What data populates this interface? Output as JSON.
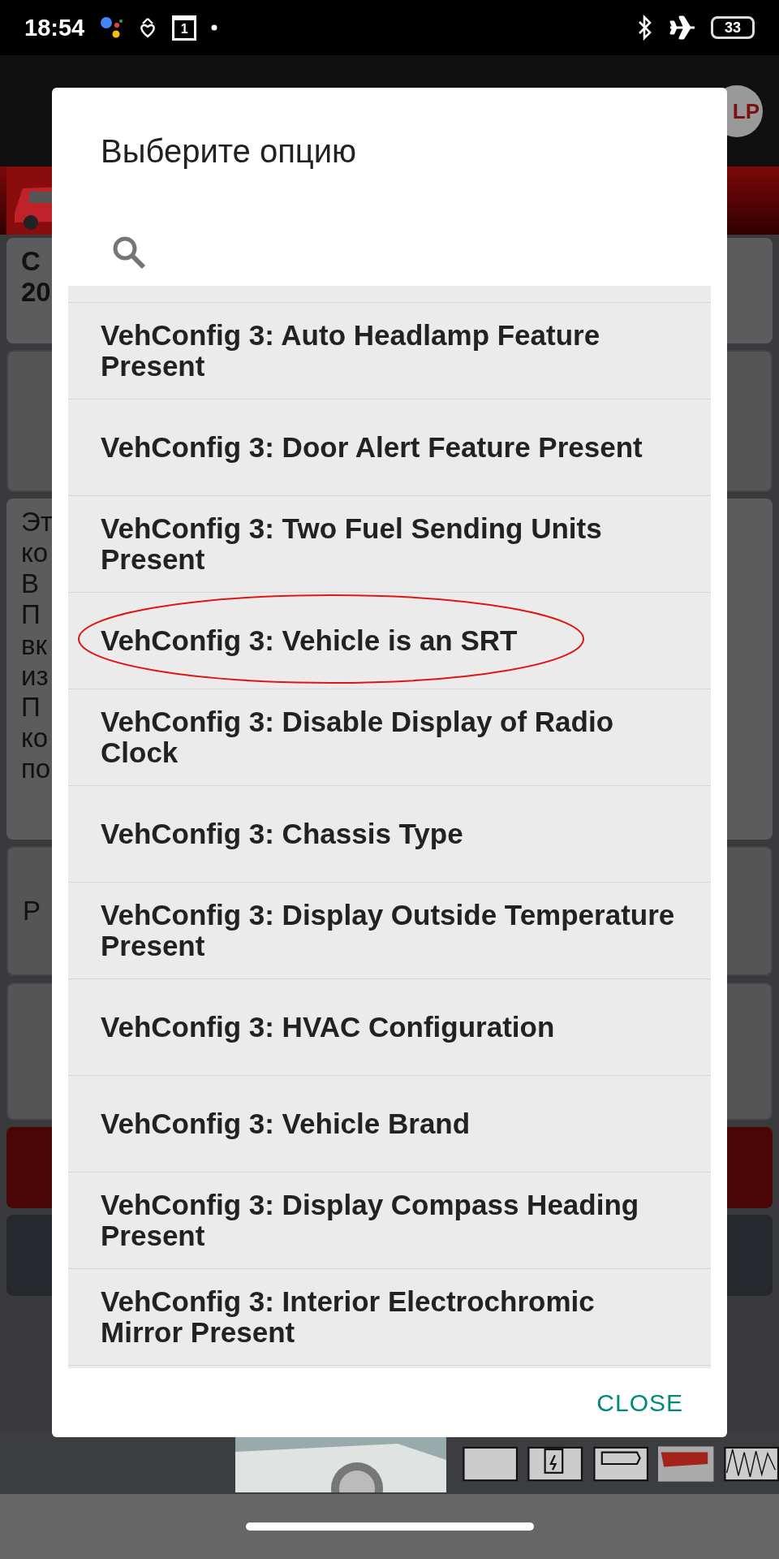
{
  "status_bar": {
    "time": "18:54",
    "calendar_day": "1",
    "battery": "33"
  },
  "background": {
    "help_label": "LP",
    "panels": [
      {
        "kind": "text",
        "lines": [
          "С",
          "20"
        ]
      },
      {
        "kind": "button"
      },
      {
        "kind": "text",
        "lines": [
          "Эт",
          "ко",
          "В",
          "П",
          "вк",
          "из",
          "П",
          "ко",
          "по"
        ]
      },
      {
        "kind": "button",
        "lines": [
          "Р"
        ]
      },
      {
        "kind": "button"
      },
      {
        "kind": "red"
      },
      {
        "kind": "dark"
      }
    ]
  },
  "dialog": {
    "title": "Выберите опцию",
    "options": [
      {
        "label": "VehConfig 3: Auto Headlamp Feature Present",
        "circled": false
      },
      {
        "label": "VehConfig 3: Door Alert Feature Present",
        "circled": false
      },
      {
        "label": "VehConfig 3: Two Fuel Sending Units Present",
        "circled": false
      },
      {
        "label": "VehConfig 3: Vehicle is an SRT",
        "circled": true
      },
      {
        "label": "VehConfig 3: Disable Display of Radio Clock",
        "circled": false
      },
      {
        "label": "VehConfig 3: Chassis Type",
        "circled": false
      },
      {
        "label": "VehConfig 3: Display Outside Temperature Present",
        "circled": false
      },
      {
        "label": "VehConfig 3: HVAC Configuration",
        "circled": false
      },
      {
        "label": "VehConfig 3: Vehicle Brand",
        "circled": false
      },
      {
        "label": "VehConfig 3: Display Compass Heading Present",
        "circled": false
      },
      {
        "label": "VehConfig 3: Interior Electrochromic Mirror Present",
        "circled": false
      }
    ],
    "close_button": "CLOSE"
  }
}
